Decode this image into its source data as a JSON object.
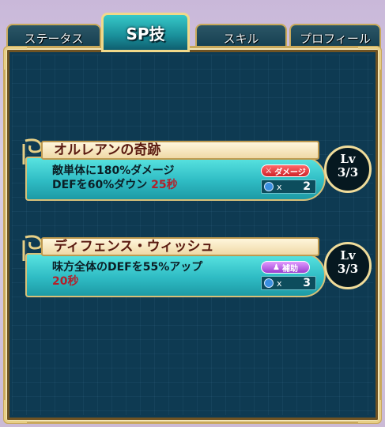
{
  "tabs": [
    {
      "label": "ステータス"
    },
    {
      "label": "SP技"
    },
    {
      "label": "スキル"
    },
    {
      "label": "プロフィール"
    }
  ],
  "sp_skills": [
    {
      "name": "オルレアンの奇跡",
      "line1": "敵単体に180%ダメージ",
      "line2": "DEFを60%ダウン",
      "duration": "25秒",
      "type": "ダメージ",
      "cost_symbol": "x",
      "cost": "2",
      "lv_label": "Lv",
      "level": "3/3"
    },
    {
      "name": "ディフェンス・ウィッシュ",
      "line1": "味方全体のDEFを55%アップ",
      "duration": "20秒",
      "type": "補助",
      "cost_symbol": "x",
      "cost": "3",
      "lv_label": "Lv",
      "level": "3/3"
    }
  ]
}
